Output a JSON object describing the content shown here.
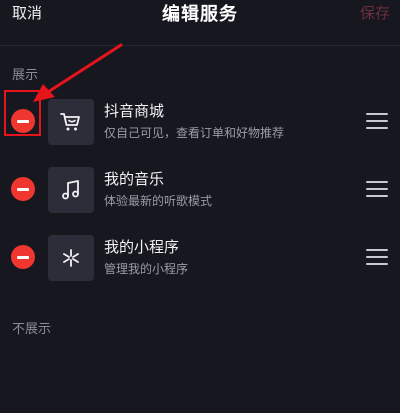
{
  "header": {
    "cancel_label": "取消",
    "title": "编辑服务",
    "save_label": "保存"
  },
  "sections": {
    "shown_label": "展示",
    "hidden_label": "不展示"
  },
  "items": [
    {
      "title": "抖音商城",
      "description": "仅自己可见，查看订单和好物推荐",
      "icon": "shopping-cart-icon"
    },
    {
      "title": "我的音乐",
      "description": "体验最新的听歌模式",
      "icon": "music-note-icon"
    },
    {
      "title": "我的小程序",
      "description": "管理我的小程序",
      "icon": "mini-program-icon"
    }
  ],
  "colors": {
    "background": "#16171f",
    "remove_button": "#f0362f",
    "annotation": "#e8141b",
    "save_disabled": "#6b2f3d"
  }
}
